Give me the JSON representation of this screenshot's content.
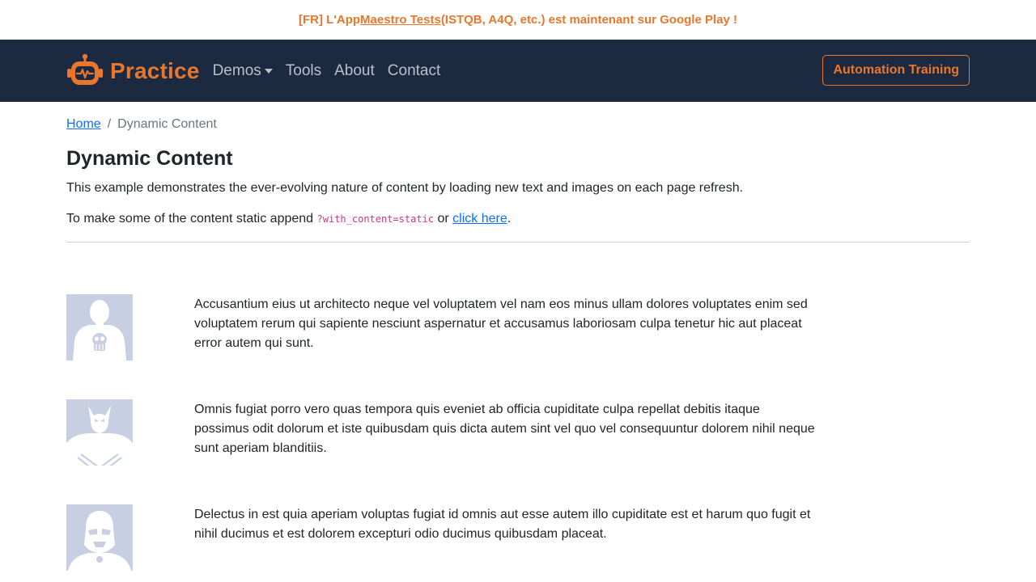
{
  "announcement": {
    "prefix": "[FR] L'App ",
    "link": "Maestro Tests",
    "suffix": " (ISTQB, A4Q, etc.) est maintenant sur Google Play !"
  },
  "navbar": {
    "brand": "Practice",
    "links": [
      "Demos",
      "Tools",
      "About",
      "Contact"
    ],
    "cta": "Automation Training"
  },
  "breadcrumb": {
    "home": "Home",
    "separator": "/",
    "current": "Dynamic Content"
  },
  "page": {
    "title": "Dynamic Content",
    "description": "This example demonstrates the ever-evolving nature of content by loading new text and images on each page refresh.",
    "static_prefix": "To make some of the content static append ",
    "static_code": "?with_content=static",
    "static_mid": " or ",
    "static_link": "click here",
    "static_end": "."
  },
  "rows": [
    {
      "avatar": "punisher-avatar",
      "text": "Accusantium eius ut architecto neque vel voluptatem vel nam eos minus ullam dolores voluptates enim sed voluptatem rerum qui sapiente nesciunt aspernatur et accusamus laboriosam culpa tenetur hic aut placeat error autem qui sunt."
    },
    {
      "avatar": "wolverine-avatar",
      "text": "Omnis fugiat porro vero quas tempora quis eveniet ab officia cupiditate culpa repellat debitis itaque possimus odit dolorum et iste quibusdam quis dicta autem sint vel quo vel consequuntur dolorem nihil neque sunt aperiam blanditiis."
    },
    {
      "avatar": "stormtrooper-avatar",
      "text": "Delectus in est quia aperiam voluptas fugiat id omnis aut esse autem illo cupiditate est et harum quo fugit et nihil ducimus et est dolorem excepturi odio ducimus quibusdam placeat."
    }
  ],
  "colors": {
    "accent": "#e8772e",
    "navbar_bg": "#1b2a41",
    "nav_link": "#b9c0ca",
    "link": "#0d6efd",
    "code": "#d63384",
    "avatar_bg": "#c8cfe2"
  }
}
